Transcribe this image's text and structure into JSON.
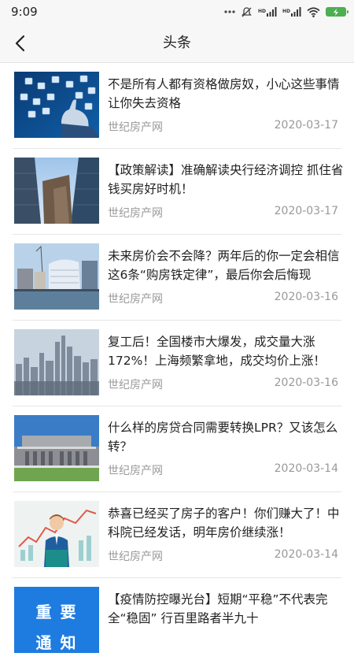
{
  "status_bar": {
    "time": "9:09",
    "signal_label_1": "HD",
    "signal_label_2": "HD",
    "battery_icon": "battery-charging-icon",
    "battery_color": "#4caf50"
  },
  "header": {
    "title": "头条",
    "back_icon": "back-arrow-icon"
  },
  "news": [
    {
      "title": "不是所有人都有资格做房奴，小心这些事情让你失去资格",
      "source": "世纪房产网",
      "date": "2020-03-17"
    },
    {
      "title": "【政策解读】准确解读央行经济调控 抓住省钱买房好时机！",
      "source": "世纪房产网",
      "date": "2020-03-17"
    },
    {
      "title": "未来房价会不会降？两年后的你一定会相信这6条“购房铁定律”，最后你会后悔现",
      "source": "世纪房产网",
      "date": "2020-03-16"
    },
    {
      "title": "复工后！全国楼市大爆发，成交量大涨172%！上海频繁拿地，成交均价上涨！",
      "source": "世纪房产网",
      "date": "2020-03-16"
    },
    {
      "title": "什么样的房贷合同需要转换LPR？又该怎么转？",
      "source": "世纪房产网",
      "date": "2020-03-14"
    },
    {
      "title": "恭喜已经买了房子的客户！你们赚大了！中科院已经发话，明年房价继续涨！",
      "source": "世纪房产网",
      "date": "2020-03-14"
    },
    {
      "title": "【疫情防控曝光台】短期“平稳”不代表完全“稳固” 行百里路者半九十",
      "source": "",
      "date": ""
    }
  ],
  "notice_thumb": {
    "line1": "重 要",
    "line2": "通 知"
  }
}
